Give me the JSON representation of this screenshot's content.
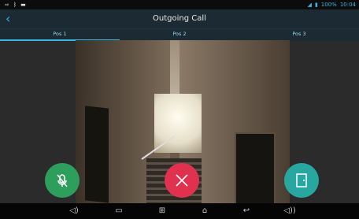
{
  "status_bar": {
    "battery": "100%",
    "time": "10:04"
  },
  "header": {
    "title": "Outgoing Call"
  },
  "tabs": [
    {
      "label": "Pos 1",
      "active": true
    },
    {
      "label": "Pos 2",
      "active": false
    },
    {
      "label": "Pos 3",
      "active": false
    }
  ],
  "actions": {
    "mute_icon": "mic-mute-icon",
    "hangup_icon": "hangup-icon",
    "door_icon": "door-icon"
  },
  "nav_bar": {
    "volume_down_icon": "volume-down-icon",
    "recent_apps_icon": "recent-apps-icon",
    "screenshot_icon": "screenshot-icon",
    "home_icon": "home-icon",
    "back_icon": "back-icon",
    "volume_up_icon": "volume-up-icon"
  },
  "colors": {
    "accent": "#33b5e5",
    "mute_button": "#2e9e5d",
    "hangup_button": "#e0314f",
    "door_button": "#27a7a0"
  }
}
